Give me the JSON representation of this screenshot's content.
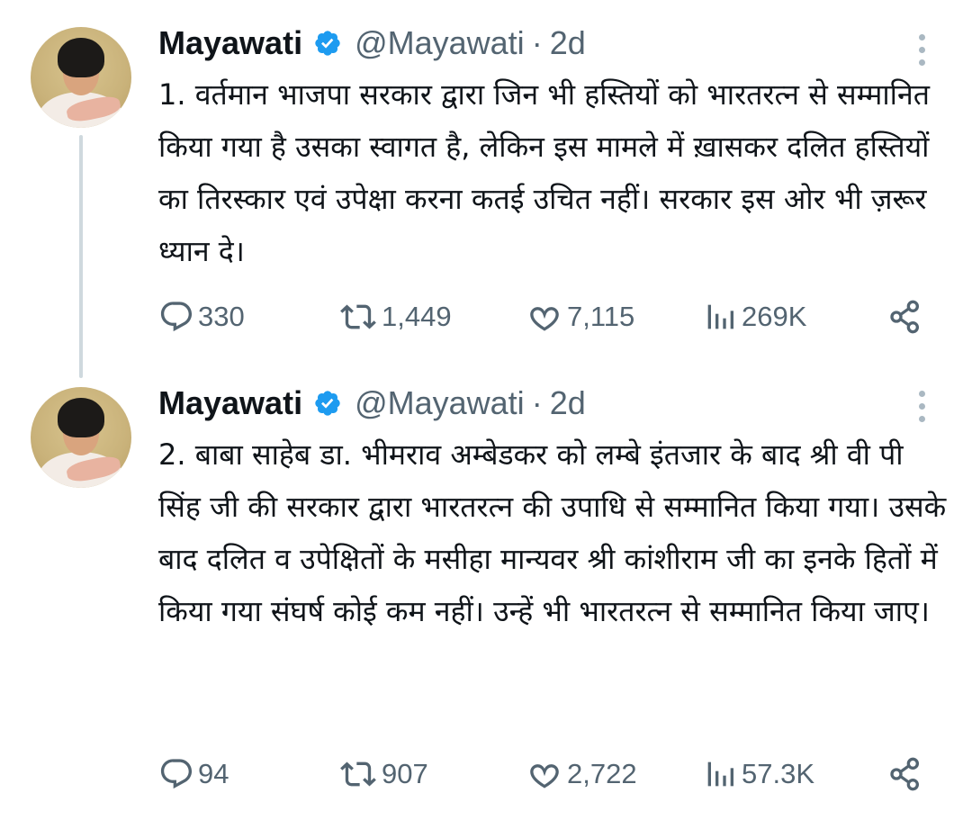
{
  "tweets": [
    {
      "name": "Mayawati",
      "handle": "@Mayawati",
      "separator": "·",
      "time": "2d",
      "text": "1. वर्तमान भाजपा सरकार द्वारा जिन भी हस्तियों को भारतरत्न से सम्मानित किया गया है उसका स्वागत है, लेकिन इस मामले में ख़ासकर दलित हस्तियों का तिरस्कार एवं उपेक्षा करना कतई उचित नहीं। सरकार इस ओर भी ज़रूर ध्यान दे।",
      "replies": "330",
      "retweets": "1,449",
      "likes": "7,115",
      "views": "269K"
    },
    {
      "name": "Mayawati",
      "handle": "@Mayawati",
      "separator": "·",
      "time": "2d",
      "text": "2. बाबा साहेब डा. भीमराव अम्बेडकर को लम्बे इंतजार के बाद श्री वी पी सिंह जी की सरकार द्वारा भारतरत्न की उपाधि से सम्मानित किया गया। उसके बाद दलित व उपेक्षितों के मसीहा मान्यवर श्री कांशीराम जी का इनके हितों में किया गया संघर्ष कोई कम नहीं। उन्हें भी भारतरत्न से सम्मानित किया जाए।",
      "replies": "94",
      "retweets": "907",
      "likes": "2,722",
      "views": "57.3K"
    }
  ],
  "icons": {
    "verified": "verified-badge-icon",
    "more": "more-vertical-icon",
    "reply": "reply-icon",
    "retweet": "retweet-icon",
    "like": "like-icon",
    "views": "views-icon",
    "share": "share-icon"
  },
  "colors": {
    "verified": "#1d9bf0",
    "muted": "#536471",
    "text": "#0f1419",
    "thread_line": "#cfd9de"
  }
}
